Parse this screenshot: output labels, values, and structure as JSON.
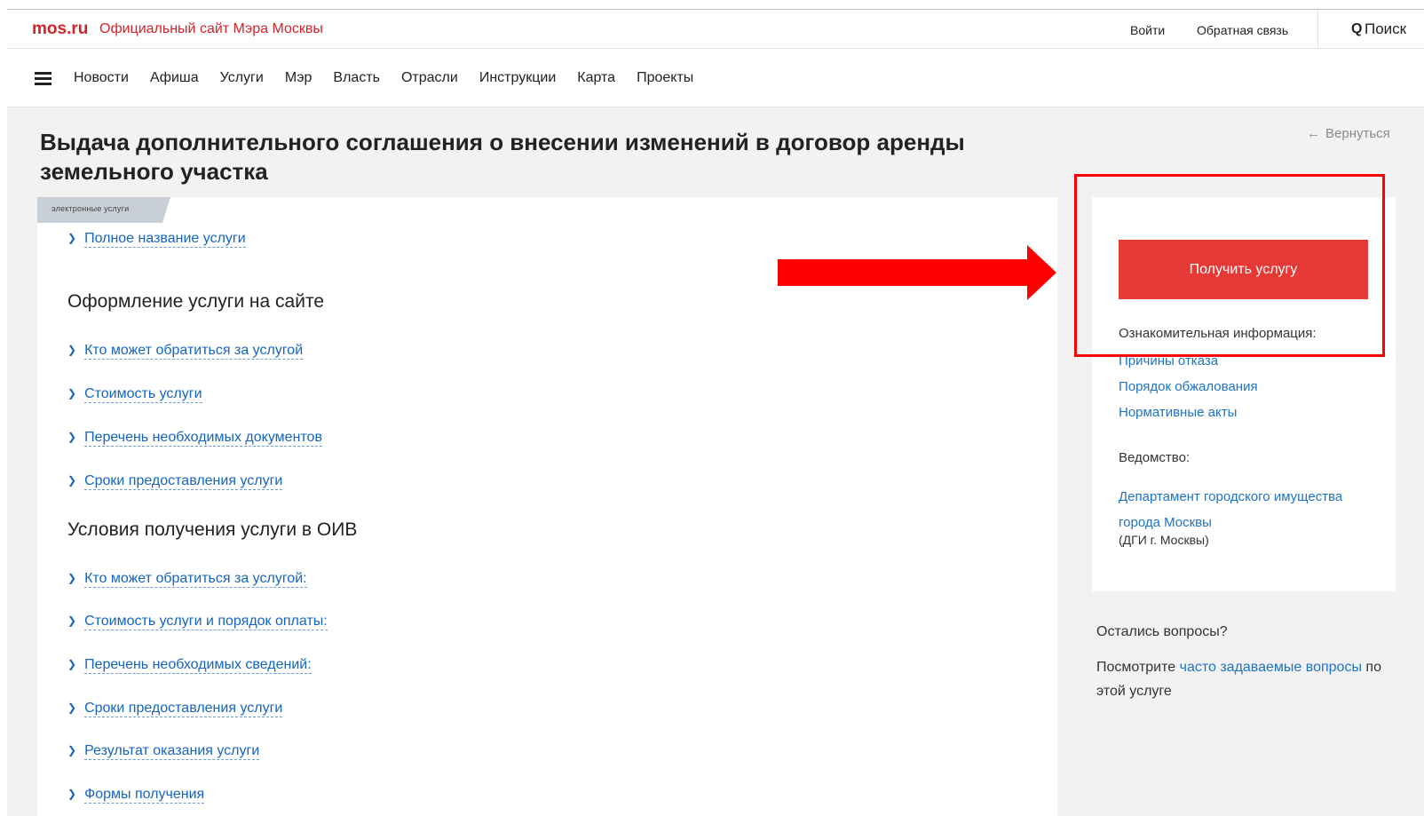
{
  "header": {
    "logo": "mos.ru",
    "site_title": "Официальный сайт Мэра Москвы",
    "login": "Войти",
    "feedback": "Обратная связь",
    "search_icon": "Q",
    "search_label": "Поиск"
  },
  "nav": {
    "items": [
      "Новости",
      "Афиша",
      "Услуги",
      "Мэр",
      "Власть",
      "Отрасли",
      "Инструкции",
      "Карта",
      "Проекты"
    ]
  },
  "page": {
    "title": "Выдача дополнительного соглашения о внесении изменений в договор аренды земельного участка",
    "back": "Вернуться",
    "back_arrow": "←",
    "ribbon": "электронные услуги"
  },
  "accordion": {
    "full_name": "Полное название услуги",
    "section1_title": "Оформление услуги на сайте",
    "section1_items": [
      "Кто может обратиться за услугой",
      "Стоимость услуги",
      "Перечень необходимых документов",
      "Сроки предоставления услуги"
    ],
    "section2_title": "Условия получения услуги в ОИВ",
    "section2_items": [
      "Кто может обратиться за услугой:",
      "Стоимость услуги и порядок оплаты:",
      "Перечень необходимых сведений:",
      "Сроки предоставления услуги",
      "Результат оказания услуги",
      "Формы получения"
    ]
  },
  "sidebar": {
    "get_service": "Получить услугу",
    "info_heading": "Ознакомительная информация:",
    "info_links": [
      "Причины отказа",
      "Порядок обжалования",
      "Нормативные акты"
    ],
    "dept_heading": "Ведомство:",
    "dept_link": "Департамент городского имущества города Москвы",
    "dept_abbr": "(ДГИ г. Москвы)",
    "questions_heading": "Остались вопросы?",
    "questions_prefix": "Посмотрите ",
    "questions_link": "часто задаваемые вопросы",
    "questions_suffix": " по этой услуге"
  },
  "colors": {
    "brand_red": "#d2232a",
    "button_red": "#e53935",
    "link_blue": "#1e73c4",
    "annotation_red": "#ff0000"
  }
}
